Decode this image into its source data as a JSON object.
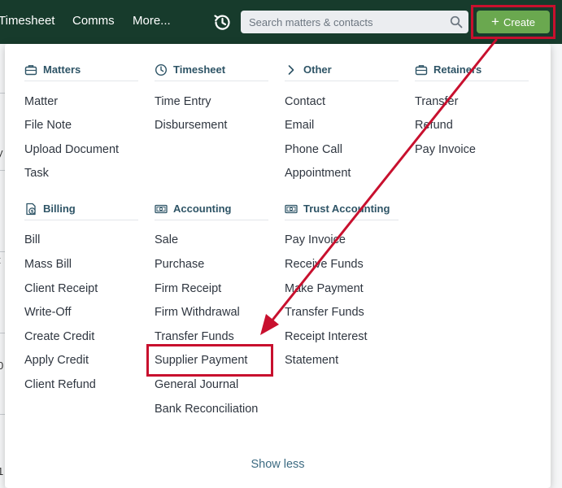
{
  "nav": {
    "items": [
      "Timesheet",
      "Comms",
      "More..."
    ],
    "search_placeholder": "Search matters & contacts",
    "create_label": "Create"
  },
  "background": {
    "left_chars": [
      "y",
      "t",
      "0",
      "1"
    ]
  },
  "menu": {
    "matters": {
      "title": "Matters",
      "items": [
        "Matter",
        "File Note",
        "Upload Document",
        "Task"
      ]
    },
    "timesheet": {
      "title": "Timesheet",
      "items": [
        "Time Entry",
        "Disbursement"
      ]
    },
    "other": {
      "title": "Other",
      "items": [
        "Contact",
        "Email",
        "Phone Call",
        "Appointment"
      ]
    },
    "retainers": {
      "title": "Retainers",
      "items": [
        "Transfer",
        "Refund",
        "Pay Invoice"
      ]
    },
    "billing": {
      "title": "Billing",
      "items": [
        "Bill",
        "Mass Bill",
        "Client Receipt",
        "Write-Off",
        "Create Credit",
        "Apply Credit",
        "Client Refund"
      ]
    },
    "accounting": {
      "title": "Accounting",
      "items": [
        "Sale",
        "Purchase",
        "Firm Receipt",
        "Firm Withdrawal",
        "Transfer Funds",
        "Supplier Payment",
        "General Journal",
        "Bank Reconciliation"
      ]
    },
    "trust": {
      "title": "Trust Accounting",
      "items": [
        "Pay Invoice",
        "Receive Funds",
        "Make Payment",
        "Transfer Funds",
        "Receipt Interest",
        "Statement"
      ]
    },
    "show_less": "Show less"
  },
  "colors": {
    "topbar": "#173b2c",
    "create_button": "#6aa84f",
    "annotation": "#c8102e",
    "section_header": "#2e5466",
    "link": "#3d6b82"
  },
  "icons": {
    "history": "history-clock-icon",
    "search": "search-icon",
    "matters": "briefcase-icon",
    "timesheet": "clock-icon",
    "other": "chevron-right-icon",
    "retainers": "briefcase-icon",
    "billing": "invoice-dollar-icon",
    "accounting": "banknote-icon",
    "trust": "banknote-icon"
  }
}
